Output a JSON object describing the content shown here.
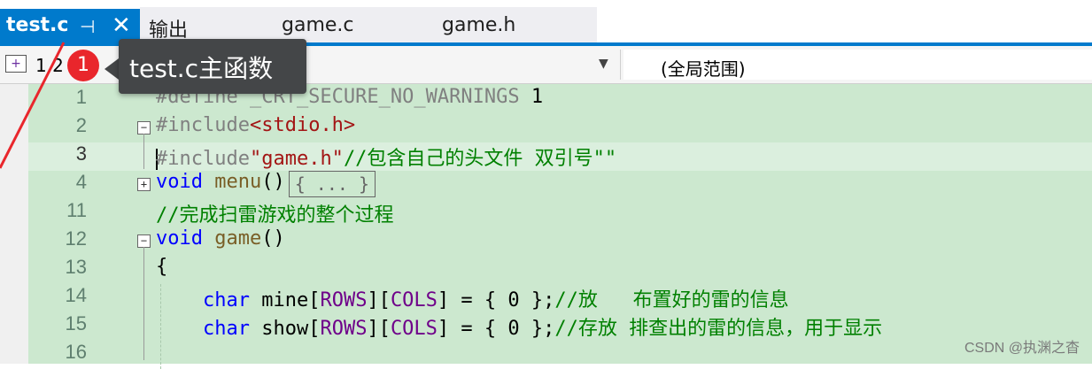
{
  "tabs": {
    "active": {
      "label": "test.c",
      "pin_glyph": "⊣",
      "close_glyph": "✕"
    },
    "others": [
      "输出",
      "game.c",
      "game.h"
    ]
  },
  "nav": {
    "left_value": "1.2",
    "right_value": "(全局范围)"
  },
  "annotation": {
    "badge": "1",
    "tooltip": "test.c主函数"
  },
  "editor": {
    "lines": [
      {
        "num": "1",
        "parts": [
          {
            "c": "pp",
            "t": "#define _CRT_SECURE_NO_WARNINGS "
          },
          {
            "c": "txt",
            "t": "1"
          }
        ]
      },
      {
        "num": "2",
        "fold": "−",
        "parts": [
          {
            "c": "pp",
            "t": "#include"
          },
          {
            "c": "str",
            "t": "<stdio.h>"
          }
        ]
      },
      {
        "num": "3",
        "current": true,
        "parts": [
          {
            "c": "pp",
            "t": "#include"
          },
          {
            "c": "str",
            "t": "\"game.h\""
          },
          {
            "c": "cmt",
            "t": "//包含自己的头文件 双引号\"\""
          }
        ]
      },
      {
        "num": "4",
        "fold": "+",
        "parts": [
          {
            "c": "k",
            "t": "void "
          },
          {
            "c": "fn",
            "t": "menu"
          },
          {
            "c": "txt",
            "t": "()"
          }
        ],
        "collapsed": "{ ... }"
      },
      {
        "num": "11",
        "parts": [
          {
            "c": "cmt",
            "t": "//完成扫雷游戏的整个过程"
          }
        ]
      },
      {
        "num": "12",
        "fold": "−",
        "parts": [
          {
            "c": "k",
            "t": "void "
          },
          {
            "c": "fn",
            "t": "game"
          },
          {
            "c": "txt",
            "t": "()"
          }
        ]
      },
      {
        "num": "13",
        "parts": [
          {
            "c": "txt",
            "t": "{"
          }
        ]
      },
      {
        "num": "14",
        "parts": [
          {
            "c": "txt",
            "t": "    "
          },
          {
            "c": "k",
            "t": "char "
          },
          {
            "c": "txt",
            "t": "mine["
          },
          {
            "c": "mac",
            "t": "ROWS"
          },
          {
            "c": "txt",
            "t": "]["
          },
          {
            "c": "mac",
            "t": "COLS"
          },
          {
            "c": "txt",
            "t": "] = { 0 };"
          },
          {
            "c": "cmt",
            "t": "//放   布置好的雷的信息"
          }
        ]
      },
      {
        "num": "15",
        "parts": [
          {
            "c": "txt",
            "t": "    "
          },
          {
            "c": "k",
            "t": "char "
          },
          {
            "c": "txt",
            "t": "show["
          },
          {
            "c": "mac",
            "t": "ROWS"
          },
          {
            "c": "txt",
            "t": "]["
          },
          {
            "c": "mac",
            "t": "COLS"
          },
          {
            "c": "txt",
            "t": "] = { 0 };"
          },
          {
            "c": "cmt",
            "t": "//存放 排查出的雷的信息，用于显示"
          }
        ]
      },
      {
        "num": "16",
        "parts": []
      }
    ]
  },
  "watermark": "CSDN @执渊之杳",
  "colors": {
    "accent": "#007acc",
    "editor_bg": "#cce8cf",
    "badge": "#e9262c",
    "tooltip_bg": "#444648"
  }
}
